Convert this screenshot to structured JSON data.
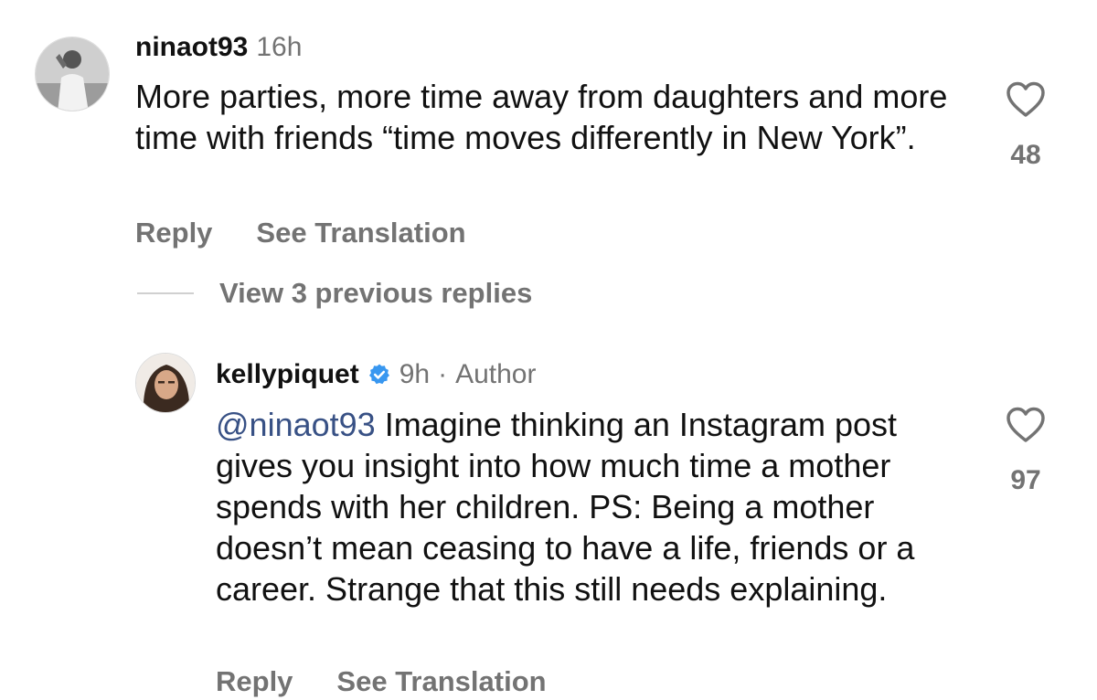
{
  "comments": [
    {
      "username": "ninaot93",
      "time": "16h",
      "text": "More parties, more time away from daughters and more time with friends “time moves differently in New York”.",
      "likes": "48",
      "reply_label": "Reply",
      "translate_label": "See Translation"
    },
    {
      "username": "kellypiquet",
      "time": "9h",
      "separator": "·",
      "badge": "Author",
      "mention": "@ninaot93",
      "text": " Imagine thinking an Instagram post gives you insight into how much time a mother spends with her children. PS: Being a mother doesn’t mean ceasing to have a life, friends or a career. Strange that this still needs explaining.",
      "likes": "97",
      "reply_label": "Reply",
      "translate_label": "See Translation",
      "verified": true
    }
  ],
  "view_replies_label": "View 3 previous replies",
  "icons": {
    "like": "heart-outline-icon",
    "verified": "verified-badge-icon"
  },
  "colors": {
    "mention": "#385185",
    "secondary_text": "#737373",
    "verified": "#3897f0"
  }
}
